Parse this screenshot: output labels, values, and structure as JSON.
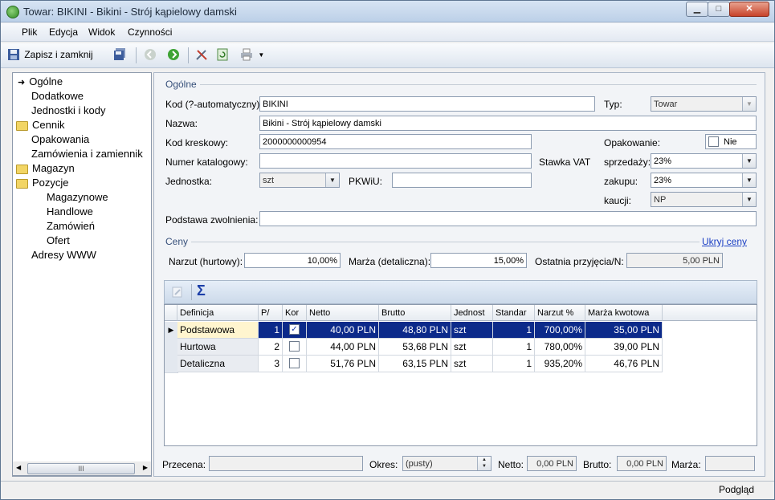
{
  "window": {
    "title": "Towar: BIKINI - Bikini - Strój kąpielowy damski",
    "min_label": "▁",
    "max_label": "□",
    "close_label": "✕"
  },
  "menu": [
    "Plik",
    "Edycja",
    "Widok",
    "Czynności"
  ],
  "toolbar": {
    "save_close_label": "Zapisz i zamknij"
  },
  "tree": {
    "items": [
      {
        "label": "Ogólne",
        "icon": "arrow-icon"
      },
      {
        "label": "Dodatkowe",
        "icon": ""
      },
      {
        "label": "Jednostki i kody",
        "icon": ""
      },
      {
        "label": "Cennik",
        "icon": "folder-icon"
      },
      {
        "label": "Opakowania",
        "icon": ""
      },
      {
        "label": "Zamówienia i zamiennik",
        "icon": ""
      },
      {
        "label": "Magazyn",
        "icon": "folder-icon"
      },
      {
        "label": "Pozycje",
        "icon": "folder-open-icon"
      },
      {
        "label": "Magazynowe",
        "icon": ""
      },
      {
        "label": "Handlowe",
        "icon": ""
      },
      {
        "label": "Zamówień",
        "icon": ""
      },
      {
        "label": "Ofert",
        "icon": ""
      },
      {
        "label": "Adresy WWW",
        "icon": ""
      }
    ],
    "scroll_grip": "III"
  },
  "general": {
    "section": "Ogólne",
    "kod_label": "Kod (?-automatyczny):",
    "kod_value": "BIKINI",
    "typ_label": "Typ:",
    "typ_value": "Towar",
    "nazwa_label": "Nazwa:",
    "nazwa_value": "Bikini - Strój kąpielowy damski",
    "kod_kreskowy_label": "Kod kreskowy:",
    "kod_kreskowy_value": "2000000000954",
    "opakowanie_label": "Opakowanie:",
    "opakowanie_value": "Nie",
    "numer_katalogowy_label": "Numer katalogowy:",
    "numer_katalogowy_value": "",
    "stawka_vat_label": "Stawka VAT",
    "sprzedazy_label": "sprzedaży:",
    "sprzedazy_value": "23%",
    "jednostka_label": "Jednostka:",
    "jednostka_value": "szt",
    "pkwiu_label": "PKWiU:",
    "pkwiu_value": "",
    "zakupu_label": "zakupu:",
    "zakupu_value": "23%",
    "kaucji_label": "kaucji:",
    "kaucji_value": "NP",
    "podstawa_label": "Podstawa zwolnienia:",
    "podstawa_value": ""
  },
  "prices": {
    "section": "Ceny",
    "hide_link": "Ukryj ceny",
    "narzut_label": "Narzut (hurtowy):",
    "narzut_value": "10,00%",
    "marza_label": "Marża (detaliczna):",
    "marza_value": "15,00%",
    "ostatnia_label": "Ostatnia przyjęcia/N:",
    "ostatnia_value": "5,00 PLN"
  },
  "grid": {
    "sigma": "Σ",
    "columns": [
      "Definicja",
      "P/",
      "Kor",
      "Netto",
      "Brutto",
      "Jednost",
      "Standar",
      "Narzut %",
      "Marża kwotowa"
    ],
    "rows": [
      {
        "definicja": "Podstawowa",
        "nr": "1",
        "kor": "✓",
        "netto": "40,00 PLN",
        "brutto": "48,80 PLN",
        "jedn": "szt",
        "std": "1",
        "narzut": "700,00%",
        "marza": "35,00 PLN"
      },
      {
        "definicja": "Hurtowa",
        "nr": "2",
        "kor": "",
        "netto": "44,00 PLN",
        "brutto": "53,68 PLN",
        "jedn": "szt",
        "std": "1",
        "narzut": "780,00%",
        "marza": "39,00 PLN"
      },
      {
        "definicja": "Detaliczna",
        "nr": "3",
        "kor": "",
        "netto": "51,76 PLN",
        "brutto": "63,15 PLN",
        "jedn": "szt",
        "std": "1",
        "narzut": "935,20%",
        "marza": "46,76 PLN"
      }
    ]
  },
  "footer": {
    "przecena_label": "Przecena:",
    "przecena_value": "",
    "okres_label": "Okres:",
    "okres_value": "(pusty)",
    "netto_label": "Netto:",
    "netto_value": "0,00 PLN",
    "brutto_label": "Brutto:",
    "brutto_value": "0,00 PLN",
    "marza_label": "Marża:",
    "marza_value": ""
  },
  "status": {
    "right_text": "Podgląd"
  }
}
